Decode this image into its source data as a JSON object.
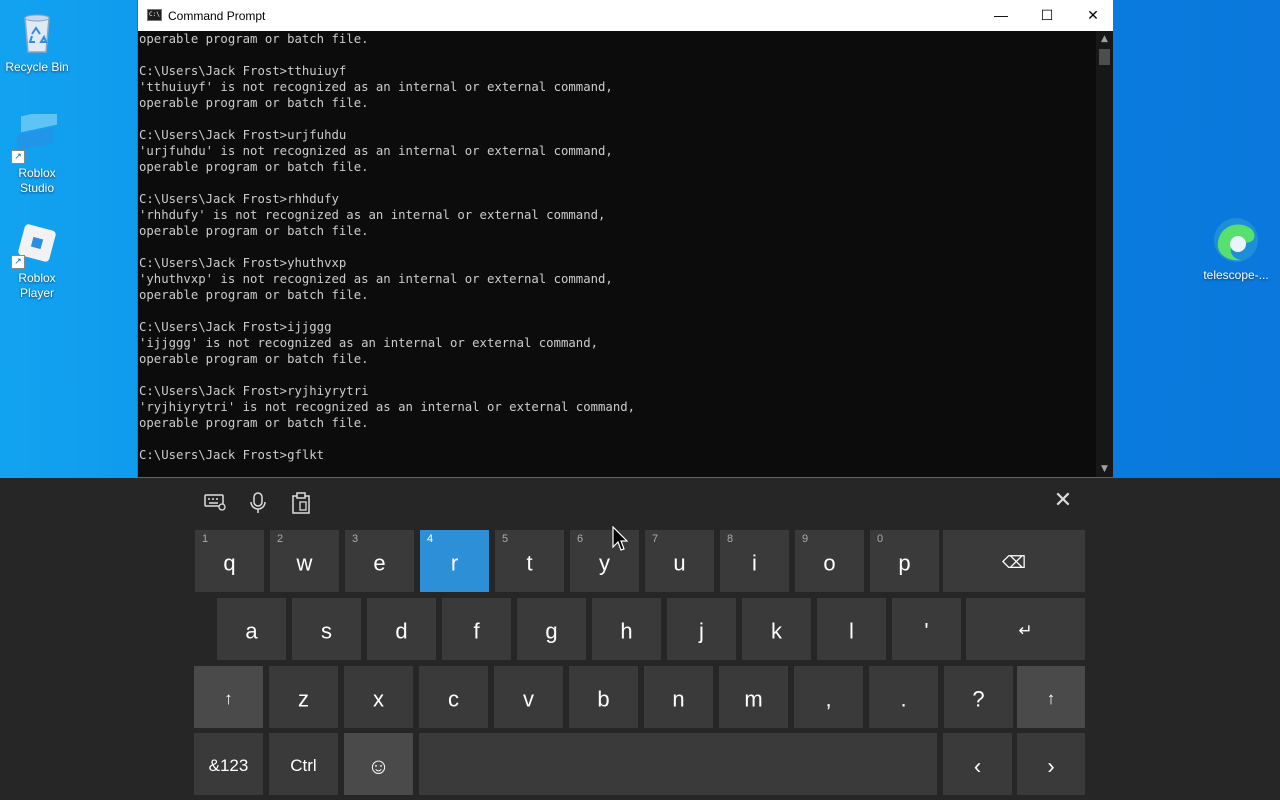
{
  "desktop": {
    "icons": [
      {
        "label": "Recycle Bin"
      },
      {
        "label": "Roblox Studio"
      },
      {
        "label": "Roblox Player"
      },
      {
        "label": "telescope-..."
      }
    ]
  },
  "window": {
    "title": "Command Prompt",
    "minimize": "—",
    "maximize": "☐",
    "close": "✕",
    "console_lines": [
      "operable program or batch file.",
      "",
      "C:\\Users\\Jack Frost>tthuiuyf",
      "'tthuiuyf' is not recognized as an internal or external command,",
      "operable program or batch file.",
      "",
      "C:\\Users\\Jack Frost>urjfuhdu",
      "'urjfuhdu' is not recognized as an internal or external command,",
      "operable program or batch file.",
      "",
      "C:\\Users\\Jack Frost>rhhdufy",
      "'rhhdufy' is not recognized as an internal or external command,",
      "operable program or batch file.",
      "",
      "C:\\Users\\Jack Frost>yhuthvxp",
      "'yhuthvxp' is not recognized as an internal or external command,",
      "operable program or batch file.",
      "",
      "C:\\Users\\Jack Frost>ijjggg",
      "'ijjggg' is not recognized as an internal or external command,",
      "operable program or batch file.",
      "",
      "C:\\Users\\Jack Frost>ryjhiyrytri",
      "'ryjhiyrytri' is not recognized as an internal or external command,",
      "operable program or batch file.",
      "",
      "C:\\Users\\Jack Frost>gflkt"
    ]
  },
  "keyboard": {
    "row1": [
      {
        "num": "1",
        "label": "q"
      },
      {
        "num": "2",
        "label": "w"
      },
      {
        "num": "3",
        "label": "e"
      },
      {
        "num": "4",
        "label": "r"
      },
      {
        "num": "5",
        "label": "t"
      },
      {
        "num": "6",
        "label": "y"
      },
      {
        "num": "7",
        "label": "u"
      },
      {
        "num": "8",
        "label": "i"
      },
      {
        "num": "9",
        "label": "o"
      },
      {
        "num": "0",
        "label": "p"
      }
    ],
    "row2": [
      "a",
      "s",
      "d",
      "f",
      "g",
      "h",
      "j",
      "k",
      "l",
      "'"
    ],
    "row3": [
      "z",
      "x",
      "c",
      "v",
      "b",
      "n",
      "m",
      ",",
      ".",
      "?"
    ],
    "backspace": "⌫",
    "enter": "↵",
    "shift": "↑",
    "symbols": "&123",
    "ctrl": "Ctrl",
    "emoji": "☺",
    "left": "‹",
    "right": "›",
    "active_key": "r",
    "close": "✕"
  }
}
